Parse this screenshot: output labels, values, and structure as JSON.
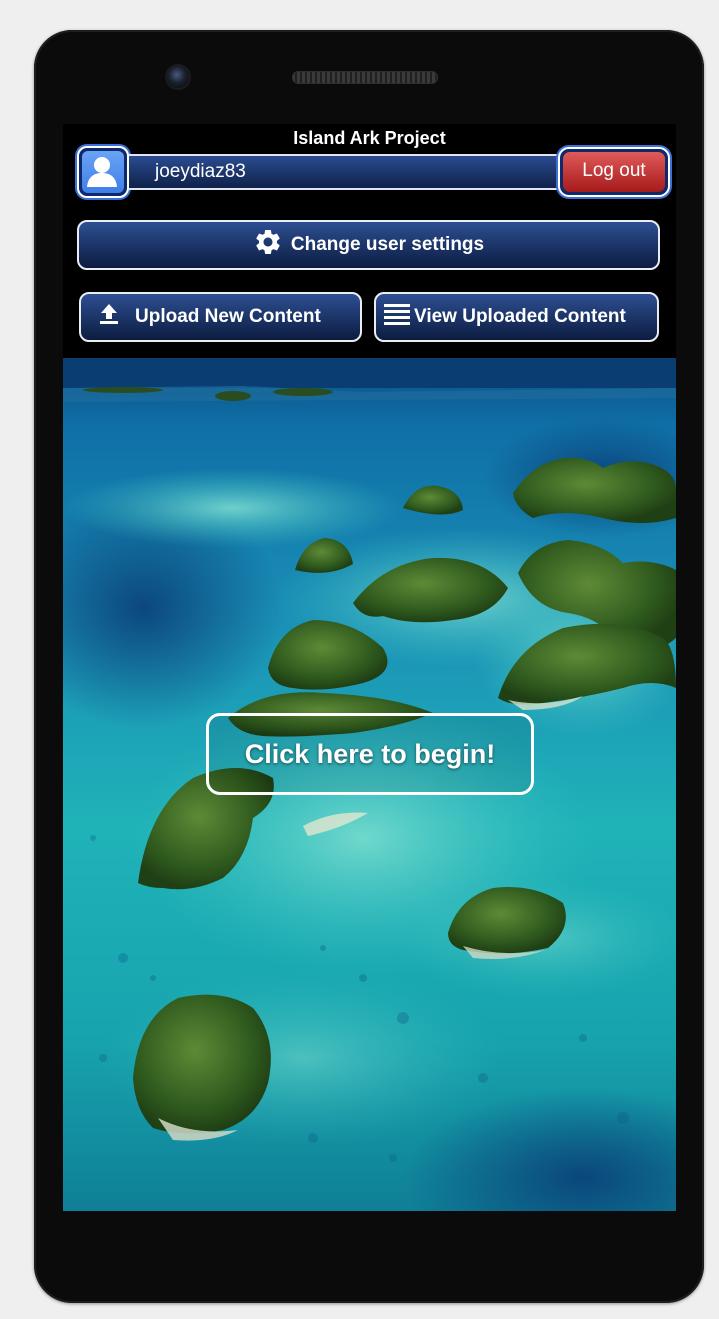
{
  "app": {
    "title": "Island Ark Project"
  },
  "user": {
    "username": "joeydiaz83",
    "logout_label": "Log out",
    "avatar_icon": "user-icon"
  },
  "actions": {
    "settings_label": "Change user settings",
    "settings_icon": "gear-icon",
    "upload_label": "Upload New Content",
    "upload_icon": "upload-icon",
    "view_label": "View Uploaded Content",
    "view_icon": "list-icon"
  },
  "hero": {
    "begin_label": "Click here to begin!"
  },
  "colors": {
    "button_blue_top": "#2d4f92",
    "button_blue_bottom": "#0c1c40",
    "logout_red_top": "#e05a5a",
    "logout_red_bottom": "#a61a1a",
    "avatar_blue": "#4f8ef0"
  }
}
